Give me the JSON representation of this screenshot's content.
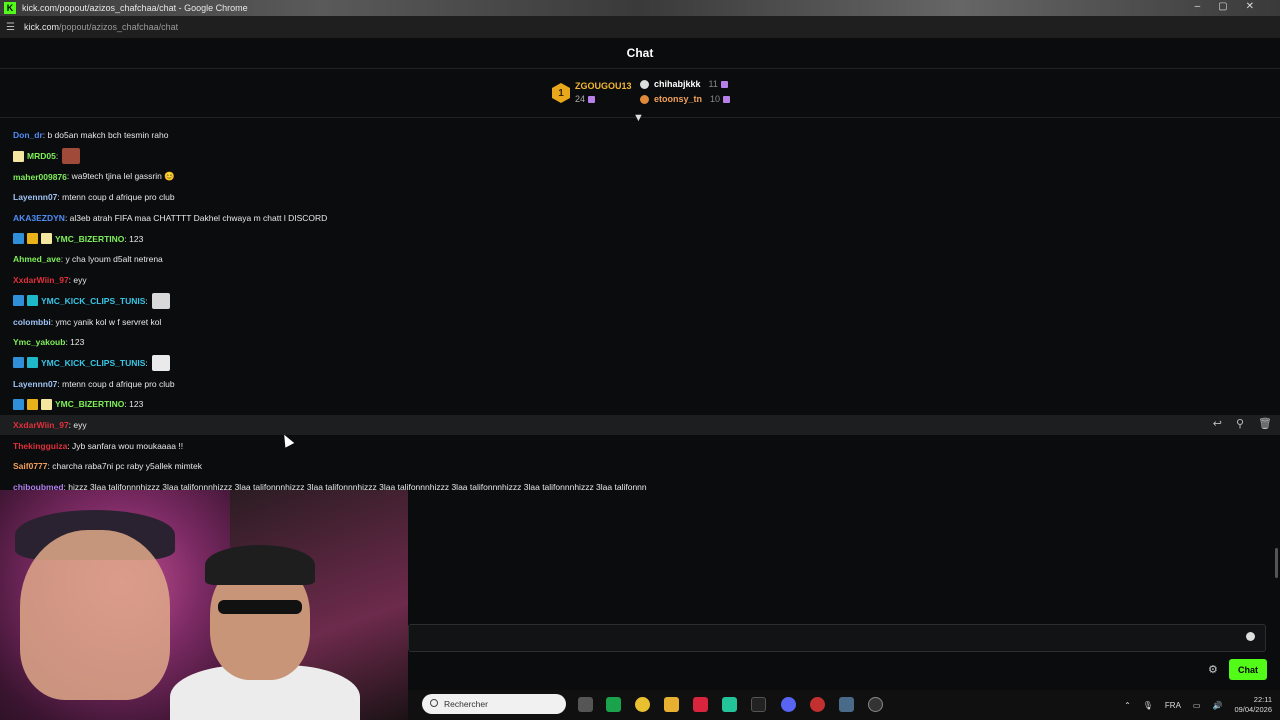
{
  "browser": {
    "title": "kick.com/popout/azizos_chafchaa/chat - Google Chrome",
    "url_host": "kick.com",
    "url_path": "/popout/azizos_chafchaa/chat"
  },
  "chat": {
    "header": "Chat",
    "top_gifters": {
      "first": {
        "rank": "1",
        "name": "ZGOUGOU13",
        "count": "24"
      },
      "second": {
        "name": "chihabjkkk",
        "count": "11"
      },
      "third": {
        "name": "etoonsy_tn",
        "count": "10"
      }
    },
    "messages": [
      {
        "user": "Don_dr",
        "color": "#4f8df7",
        "text": ": b do5an makch bch tesmin raho",
        "badges": []
      },
      {
        "user": "MRD05",
        "color": "#7ff05a",
        "text": ":",
        "badges": [
          "cream"
        ],
        "emote": "#a04a3a"
      },
      {
        "user": "maher009876",
        "color": "#7ff05a",
        "text": ": wa9tech tjina lel gassrin 😊",
        "badges": []
      },
      {
        "user": "Layennn07",
        "color": "#9fc3f5",
        "text": ": mtenn coup d afrique pro club",
        "badges": []
      },
      {
        "user": "AKA3EZDYN",
        "color": "#4f8df7",
        "text": ": al3eb atrah FIFA maa CHATTTT Dakhel chwaya m chatt l DISCORD",
        "badges": []
      },
      {
        "user": "YMC_BIZERTINO",
        "color": "#7ff05a",
        "text": ": 123",
        "badges": [
          "blue",
          "gold",
          "cream"
        ]
      },
      {
        "user": "Ahmed_ave",
        "color": "#7ff05a",
        "text": ": y cha lyoum d5alt netrena",
        "badges": []
      },
      {
        "user": "XxdarWiin_97",
        "color": "#e0303c",
        "text": ": eyy",
        "badges": []
      },
      {
        "user": "YMC_KICK_CLIPS_TUNIS",
        "color": "#39c6e8",
        "text": ":",
        "badges": [
          "blue",
          "cyan"
        ],
        "emote": "#d8d8d8"
      },
      {
        "user": "colombbi",
        "color": "#9fc3f5",
        "text": ": ymc yanik kol w f servret kol",
        "badges": []
      },
      {
        "user": "Ymc_yakoub",
        "color": "#7ff05a",
        "text": ": 123",
        "badges": []
      },
      {
        "user": "YMC_KICK_CLIPS_TUNIS",
        "color": "#39c6e8",
        "text": ":",
        "badges": [
          "blue",
          "cyan"
        ],
        "emote": "#eaeaea"
      },
      {
        "user": "Layennn07",
        "color": "#9fc3f5",
        "text": ": mtenn coup d afrique pro club",
        "badges": []
      },
      {
        "user": "YMC_BIZERTINO",
        "color": "#7ff05a",
        "text": ": 123",
        "badges": [
          "blue",
          "gold",
          "cream"
        ]
      },
      {
        "user": "XxdarWiin_97",
        "color": "#e0303c",
        "text": ": eyy",
        "badges": [],
        "hover": true
      },
      {
        "user": "Thekingguiza",
        "color": "#e0303c",
        "text": ": Jyb sanfara wou moukaaaa !!",
        "badges": []
      },
      {
        "user": "Saif0777",
        "color": "#f2a05a",
        "text": ": charcha raba7ni pc raby y5allek mimtek",
        "badges": []
      },
      {
        "user": "chiboubmed",
        "color": "#b37ff0",
        "text": ": hizzz 3laa talifonnnhizzz 3laa talifonnnhizzz 3laa talifonnnhizzz 3laa talifonnnhizzz 3laa talifonnnhizzz 3laa talifonnnhizzz 3laa talifonnnhizzz 3laa talifonnn",
        "badges": []
      }
    ],
    "send_label": "Chat"
  },
  "taskbar": {
    "search_placeholder": "Rechercher",
    "lang": "FRA",
    "time": "22:11",
    "date": "09/04/2026"
  },
  "colors": {
    "accent": "#53fc18",
    "background": "#0b0c0d"
  }
}
